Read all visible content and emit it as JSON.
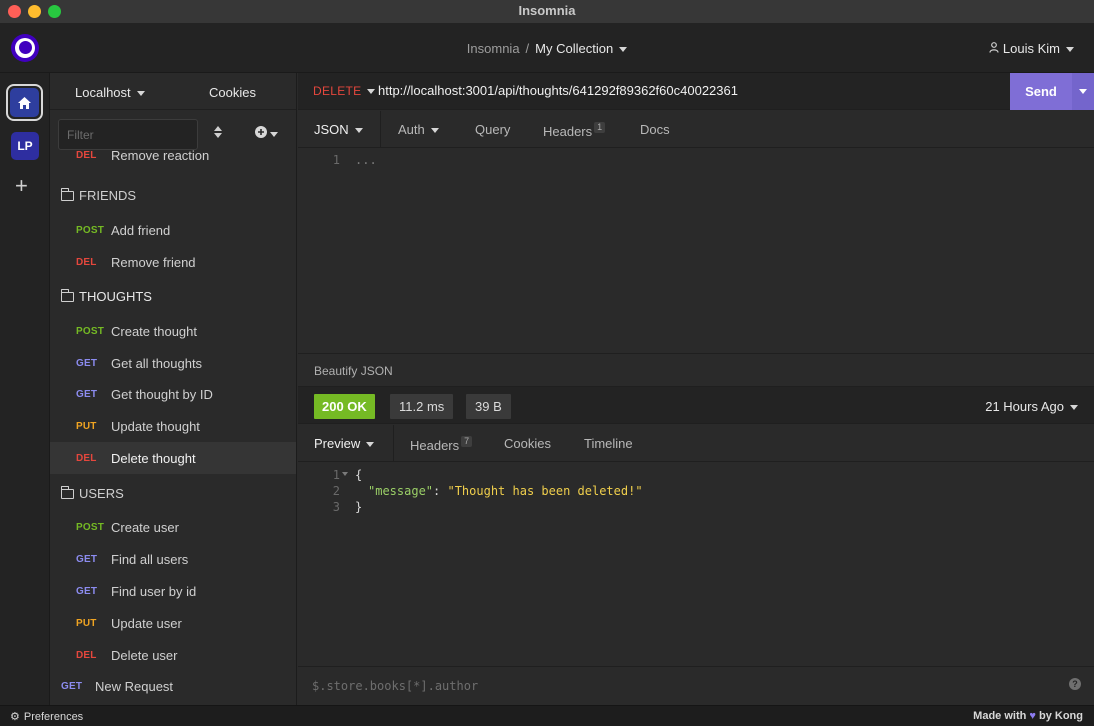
{
  "window": {
    "title": "Insomnia"
  },
  "header": {
    "breadcrumb_root": "Insomnia",
    "breadcrumb_sep": "/",
    "breadcrumb_current": "My Collection",
    "user_name": "Louis Kim"
  },
  "rail": {
    "project_initials": "LP",
    "add_label": "+"
  },
  "sidebar": {
    "environment": "Localhost",
    "cookies": "Cookies",
    "filter_placeholder": "Filter",
    "partial_item": {
      "method": "DEL",
      "name": "Remove reaction"
    },
    "groups": [
      {
        "name": "FRIENDS",
        "items": [
          {
            "method": "POST",
            "name": "Add friend"
          },
          {
            "method": "DEL",
            "name": "Remove friend"
          }
        ]
      },
      {
        "name": "THOUGHTS",
        "items": [
          {
            "method": "POST",
            "name": "Create thought"
          },
          {
            "method": "GET",
            "name": "Get all thoughts"
          },
          {
            "method": "GET",
            "name": "Get thought by ID"
          },
          {
            "method": "PUT",
            "name": "Update thought"
          },
          {
            "method": "DEL",
            "name": "Delete thought"
          }
        ]
      },
      {
        "name": "USERS",
        "items": [
          {
            "method": "POST",
            "name": "Create user"
          },
          {
            "method": "GET",
            "name": "Find all users"
          },
          {
            "method": "GET",
            "name": "Find user by id"
          },
          {
            "method": "PUT",
            "name": "Update user"
          },
          {
            "method": "DEL",
            "name": "Delete user"
          }
        ]
      }
    ],
    "root_item": {
      "method": "GET",
      "name": "New Request"
    }
  },
  "request": {
    "method": "DELETE",
    "url": "http://localhost:3001/api/thoughts/641292f89362f60c40022361",
    "send_label": "Send",
    "tabs": {
      "body": "JSON",
      "auth": "Auth",
      "query": "Query",
      "headers": "Headers",
      "headers_count": "1",
      "docs": "Docs"
    },
    "editor": {
      "line1_no": "1",
      "line1_text": "..."
    },
    "beautify_label": "Beautify JSON"
  },
  "response": {
    "status": "200 OK",
    "time": "11.2 ms",
    "size": "39 B",
    "received": "21 Hours Ago",
    "tabs": {
      "preview": "Preview",
      "headers": "Headers",
      "headers_count": "7",
      "cookies": "Cookies",
      "timeline": "Timeline"
    },
    "body": {
      "line1_no": "1",
      "line1": "{",
      "line2_no": "2",
      "key": "\"message\"",
      "colon": ": ",
      "value": "\"Thought has been deleted!\"",
      "line3_no": "3",
      "line3": "}"
    },
    "filter_placeholder": "$.store.books[*].author",
    "help": "?"
  },
  "footer": {
    "preferences": "Preferences",
    "made_with": "Made with",
    "by": "by Kong"
  },
  "colors": {
    "accent": "#7f6ed6",
    "post": "#75ba24",
    "get": "#8c8cf0",
    "del": "#e5473d",
    "put": "#f0a422",
    "ok": "#75ba24"
  }
}
